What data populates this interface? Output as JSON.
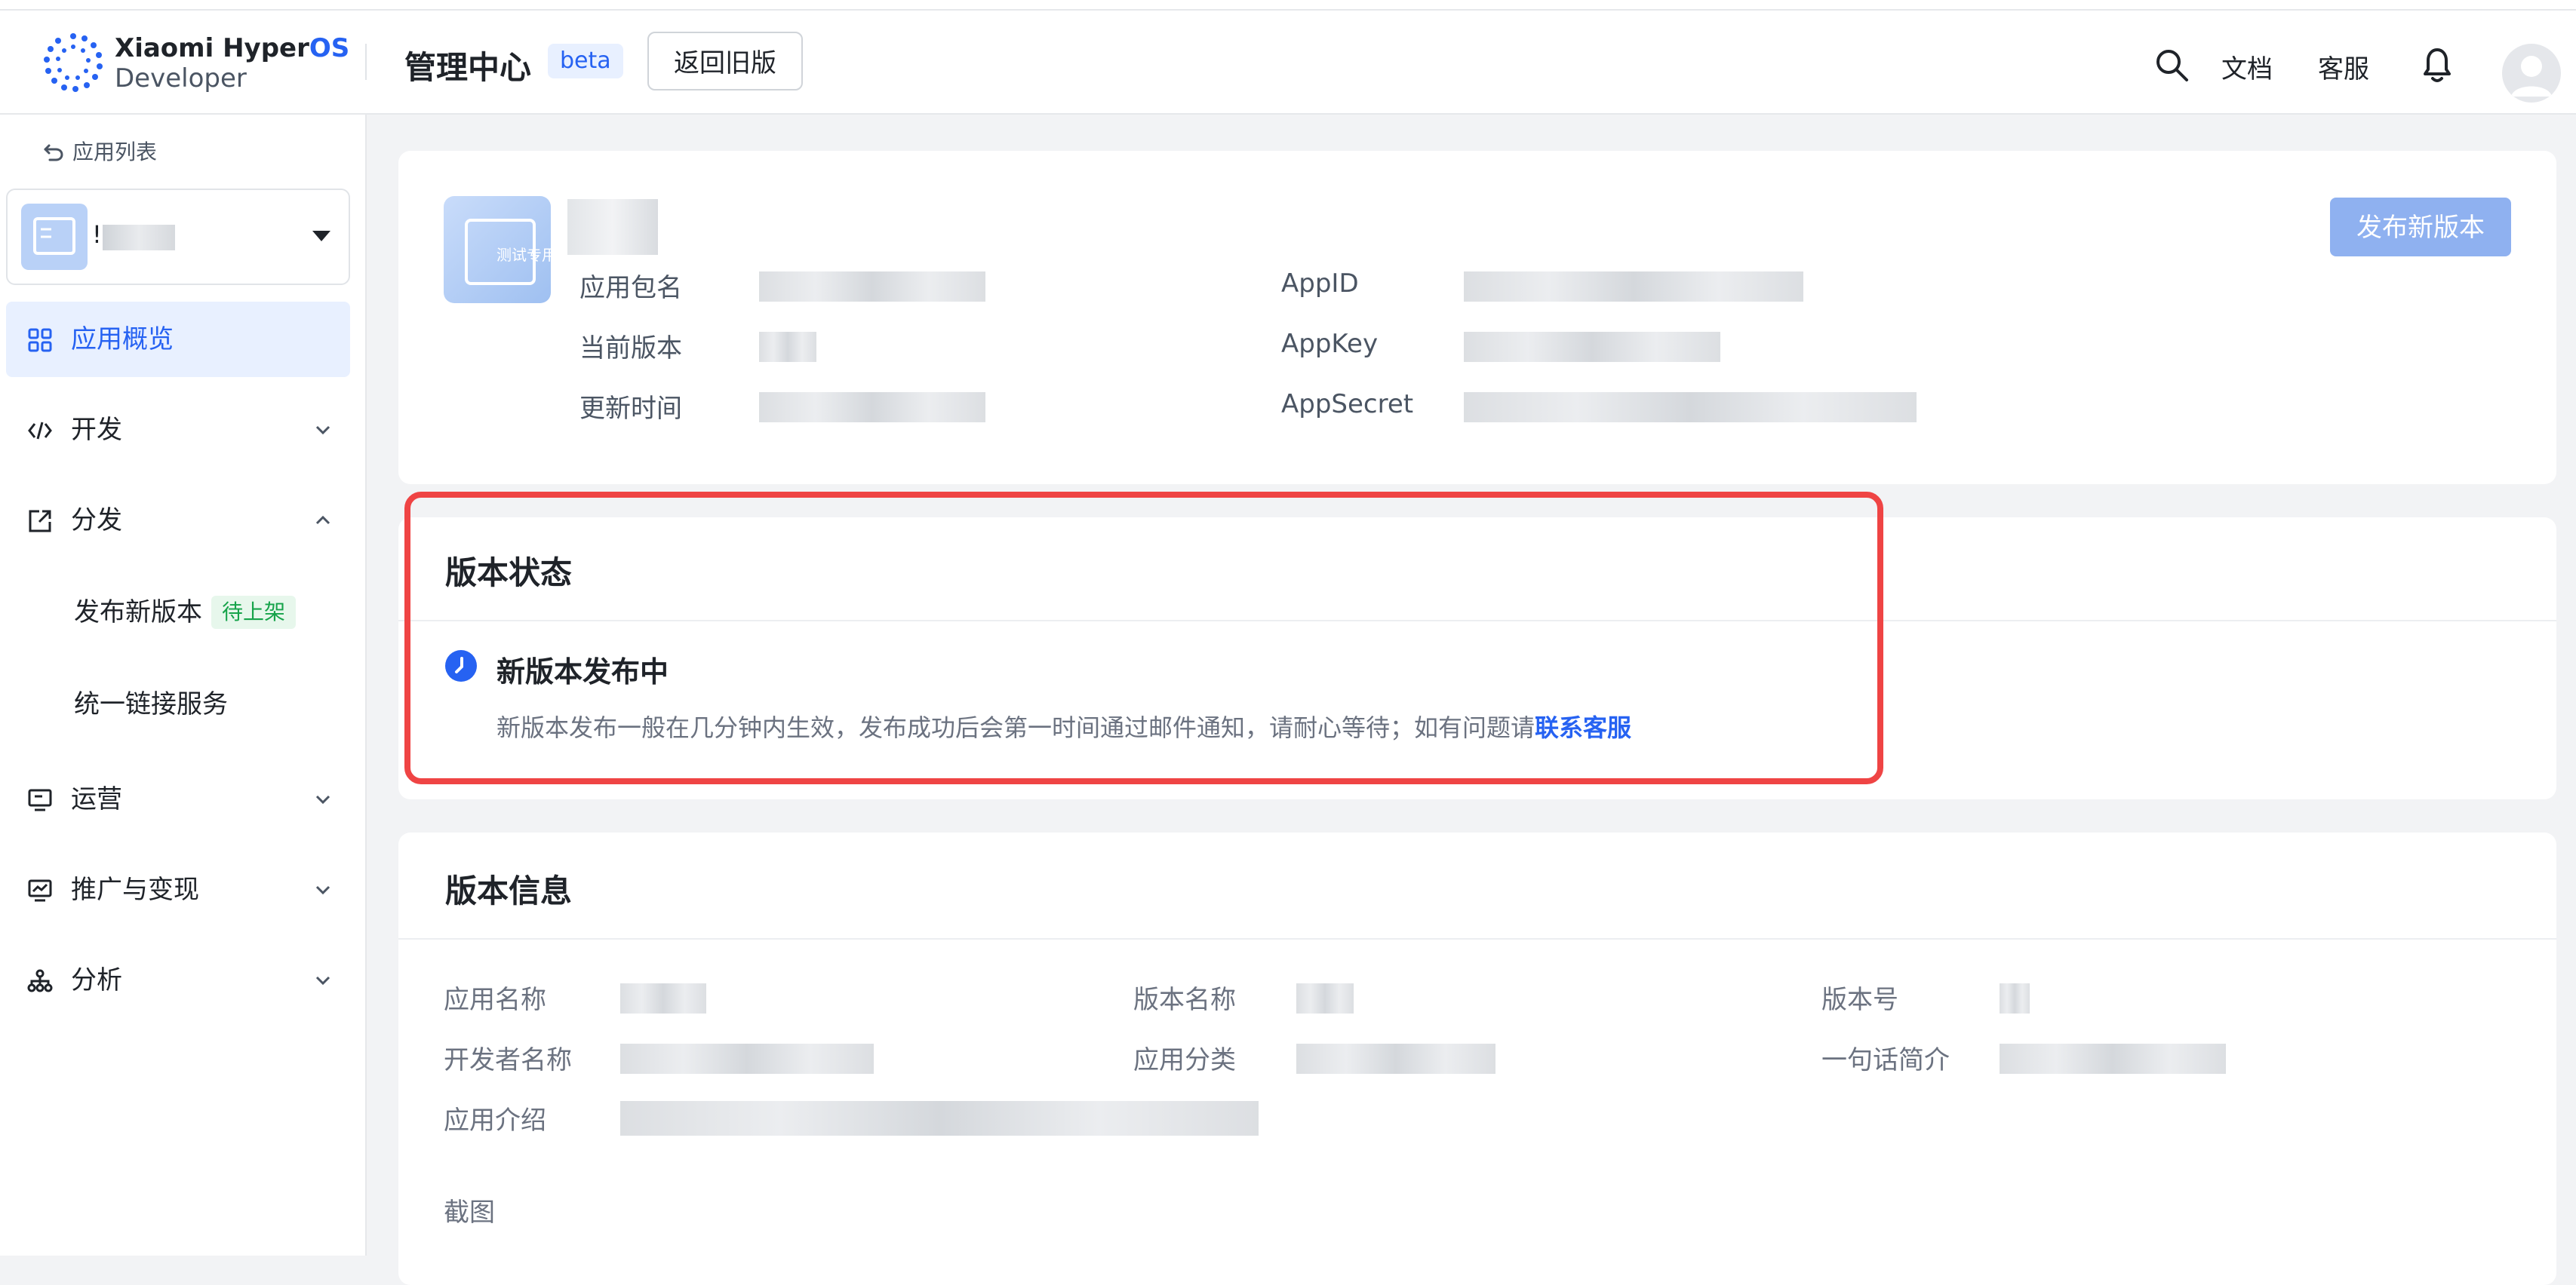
{
  "header": {
    "brand_line1_a": "Xiaomi Hyper",
    "brand_line1_b": "OS",
    "brand_line2": "Developer",
    "title": "管理中心",
    "beta": "beta",
    "old_version_button": "返回旧版",
    "docs": "文档",
    "service": "客服",
    "colors": {
      "accent": "#2662f2",
      "highlight_frame": "#ef4444"
    },
    "icons": [
      "search-icon",
      "bell-icon",
      "avatar-icon"
    ]
  },
  "sidebar": {
    "back_label": "应用列表",
    "app_name_prefix": "!",
    "items": {
      "overview": "应用概览",
      "develop": "开发",
      "distribute": "分发",
      "publish_new": "发布新版本",
      "pending_badge": "待上架",
      "unified_link": "统一链接服务",
      "operations": "运营",
      "promotion": "推广与变现",
      "analysis": "分析"
    }
  },
  "app_card": {
    "icon_text": "测试专用",
    "package_label": "应用包名",
    "version_label": "当前版本",
    "updated_label": "更新时间",
    "appid_label": "AppID",
    "appkey_label": "AppKey",
    "appsecret_label": "AppSecret",
    "publish_button": "发布新版本"
  },
  "status": {
    "title": "版本状态",
    "state": "新版本发布中",
    "desc": "新版本发布一般在几分钟内生效，发布成功后会第一时间通过邮件通知，请耐心等待；如有问题请",
    "link": "联系客服"
  },
  "version_info": {
    "title": "版本信息",
    "app_name": "应用名称",
    "version_name": "版本名称",
    "version_code": "版本号",
    "developer": "开发者名称",
    "category": "应用分类",
    "one_line": "一句话简介",
    "description": "应用介绍",
    "screenshots": "截图"
  }
}
